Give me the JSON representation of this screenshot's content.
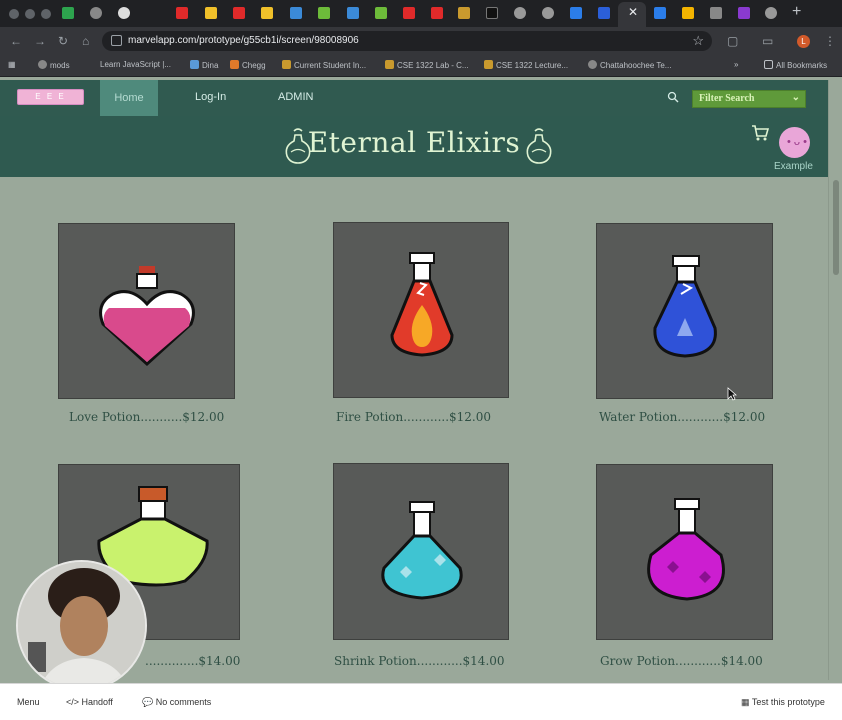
{
  "browser": {
    "url": "marvelapp.com/prototype/g55cb1i/screen/98008906",
    "bookmarks": [
      "mods",
      "Learn JavaScript |...",
      "Dina",
      "Chegg",
      "Current Student In...",
      "CSE 1322 Lab - C...",
      "CSE 1322 Lecture...",
      "Chattahoochee Te..."
    ],
    "all_bookmarks": "All Bookmarks",
    "profile_initial": "L"
  },
  "site": {
    "logo_text": "E E E",
    "nav": {
      "home": "Home",
      "login": "Log-In",
      "admin": "ADMIN"
    },
    "filter_label": "Filter Search",
    "title": "Eternal Elixirs",
    "avatar_label": "Example"
  },
  "products": [
    {
      "name": "Love Potion",
      "caption": "Love Potion...........$12.00",
      "color": "#d94a8c"
    },
    {
      "name": "Fire Potion",
      "caption": "Fire Potion............$12.00",
      "color": "#e13b2a"
    },
    {
      "name": "Water Potion",
      "caption": "Water Potion............$12.00",
      "color": "#2f52d8"
    },
    {
      "name": "Potion",
      "caption": "..............$14.00",
      "color": "#c9f26d"
    },
    {
      "name": "Shrink Potion",
      "caption": "Shrink Potion............$14.00",
      "color": "#3fc4d2"
    },
    {
      "name": "Grow Potion",
      "caption": "Grow Potion............$14.00",
      "color": "#cc1ed0"
    }
  ],
  "toolbar": {
    "menu": "Menu",
    "handoff": "Handoff",
    "comments": "No comments",
    "test": "Test this prototype"
  },
  "colors": {
    "page_bg": "#9aa89a",
    "header_bg": "#2f5a50",
    "accent_home": "#4f8a7c",
    "filter_bg": "#5f9a3a"
  }
}
